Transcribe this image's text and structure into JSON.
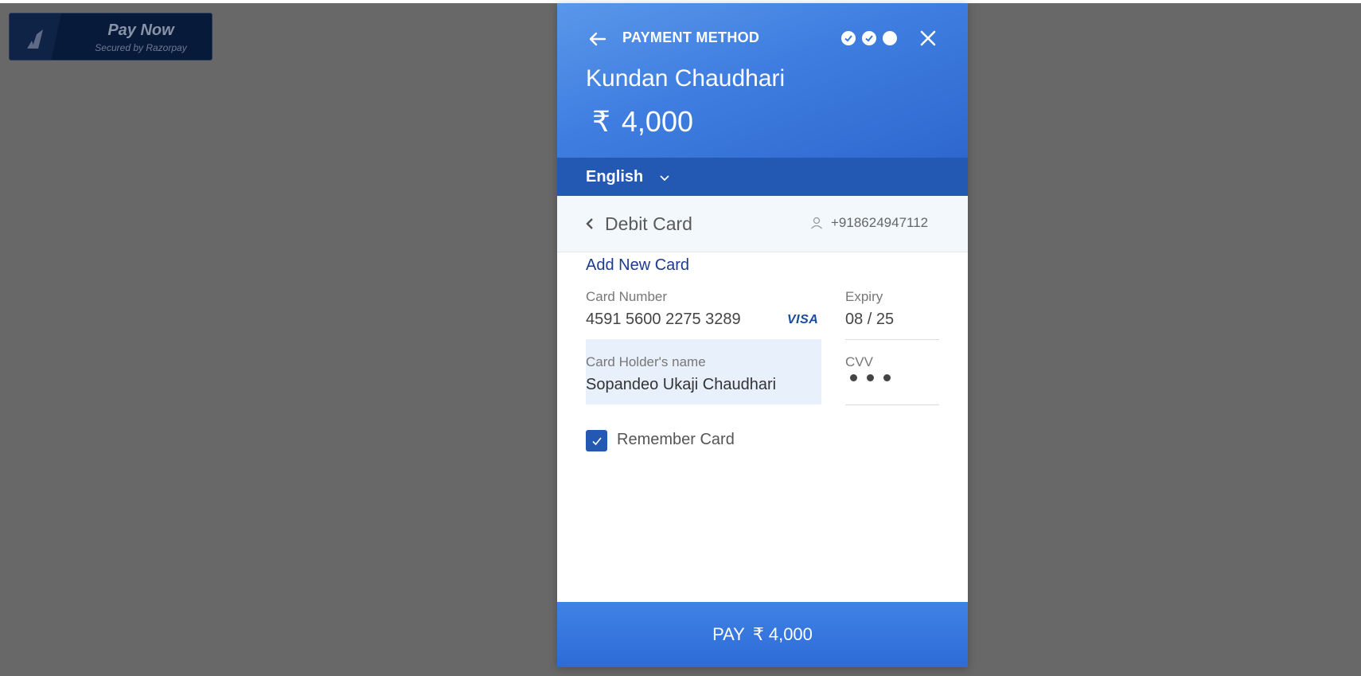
{
  "badge": {
    "title": "Pay Now",
    "subtitle": "Secured by Razorpay"
  },
  "header": {
    "title": "PAYMENT METHOD",
    "merchant": "Kundan Chaudhari",
    "currency_symbol": "₹",
    "amount": "4,000",
    "steps": [
      "completed",
      "completed",
      "current"
    ]
  },
  "language": {
    "selected": "English"
  },
  "method": {
    "title": "Debit Card",
    "phone": "+918624947112"
  },
  "card_form": {
    "add_new_label": "Add New Card",
    "card_number_label": "Card Number",
    "card_number_value": "4591 5600 2275 3289",
    "card_brand": "VISA",
    "expiry_label": "Expiry",
    "expiry_value": "08 / 25",
    "holder_label": "Card Holder's name",
    "holder_value": "Sopandeo Ukaji Chaudhari",
    "cvv_label": "CVV",
    "cvv_masked_length": 3,
    "remember_label": "Remember Card",
    "remember_checked": true
  },
  "pay_button": {
    "label": "PAY",
    "currency_symbol": "₹",
    "amount": "4,000"
  },
  "colors": {
    "primary": "#2358b3",
    "header_gradient_start": "#5a97ea",
    "overlay": "#686868",
    "badge_bg": "#071a3a"
  }
}
